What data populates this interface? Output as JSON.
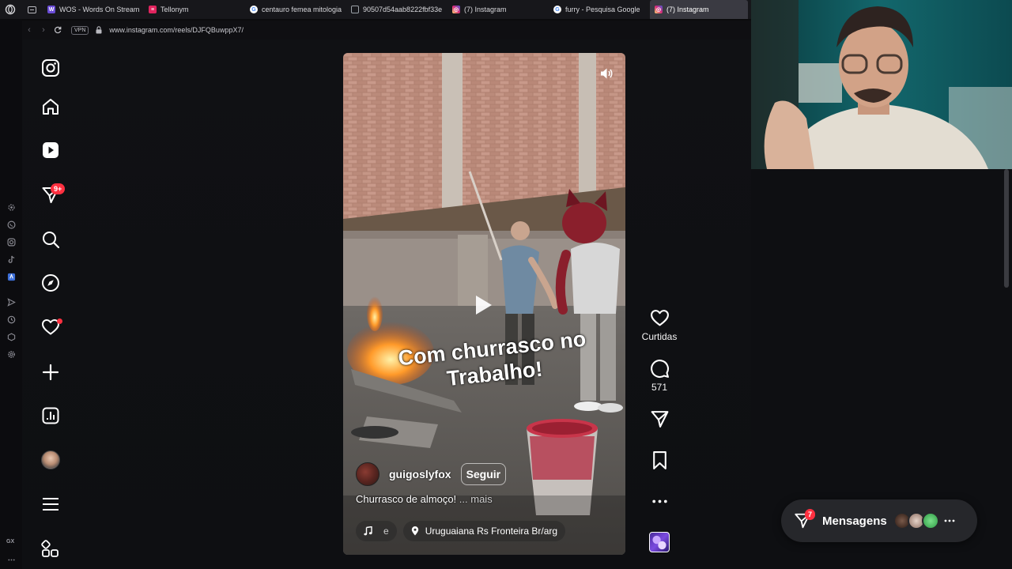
{
  "browser": {
    "tabs": [
      {
        "title": "WOS - Words On Stream",
        "favicon_color": "#6a4cd6",
        "active": false
      },
      {
        "title": "Tellonym",
        "favicon_color": "#e0245e",
        "active": false
      },
      {
        "title": "centauro femea mitologia",
        "favicon_color": "#4285f4",
        "active": false
      },
      {
        "title": "90507d54aab8222fbf33e",
        "favicon_color": "#9aa0a6",
        "active": false
      },
      {
        "title": "(7) Instagram",
        "favicon_color": "#d6249f",
        "active": false
      },
      {
        "title": "furry - Pesquisa Google",
        "favicon_color": "#4285f4",
        "active": false
      },
      {
        "title": "(7) Instagram",
        "favicon_color": "#d6249f",
        "active": true
      }
    ],
    "vpn_label": "VPN",
    "url": "www.instagram.com/reels/DJFQBuwppX7/",
    "sidebar_label": "GX"
  },
  "instagram": {
    "nav": {
      "notifications_badge": "9+"
    },
    "reel": {
      "overlay_text_line1": "Com churrasco no",
      "overlay_text_line2": "Trabalho!",
      "author": "guigoslyfox",
      "follow_label": "Seguir",
      "caption": "Churrasco de almoço!",
      "more_label": "... mais",
      "audio_text": "e",
      "location": "Uruguaiana Rs Fronteira Br/arg"
    },
    "actions": {
      "likes_label": "Curtidas",
      "comments_count": "571"
    },
    "messages": {
      "label": "Mensagens",
      "badge": "7"
    }
  },
  "colors": {
    "accent_red": "#ff3040",
    "background": "#0e0f12",
    "webcam_wall": "#0f5a60"
  }
}
